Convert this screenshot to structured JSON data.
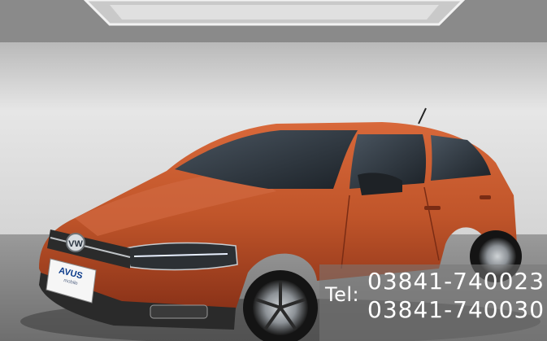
{
  "image": {
    "description_color_body": "#c0552a",
    "colors": {
      "car_body": "#c0552a",
      "car_body_dark": "#8a3218",
      "wall": "#d8d8d8",
      "floor": "#8c8c8c",
      "overlay": "#787878"
    }
  },
  "contact": {
    "prefix": "Tel:",
    "phone_1": "03841-740023",
    "phone_2": "03841-740030"
  },
  "plate": {
    "brand": "AVUS",
    "sub": "mobile"
  }
}
